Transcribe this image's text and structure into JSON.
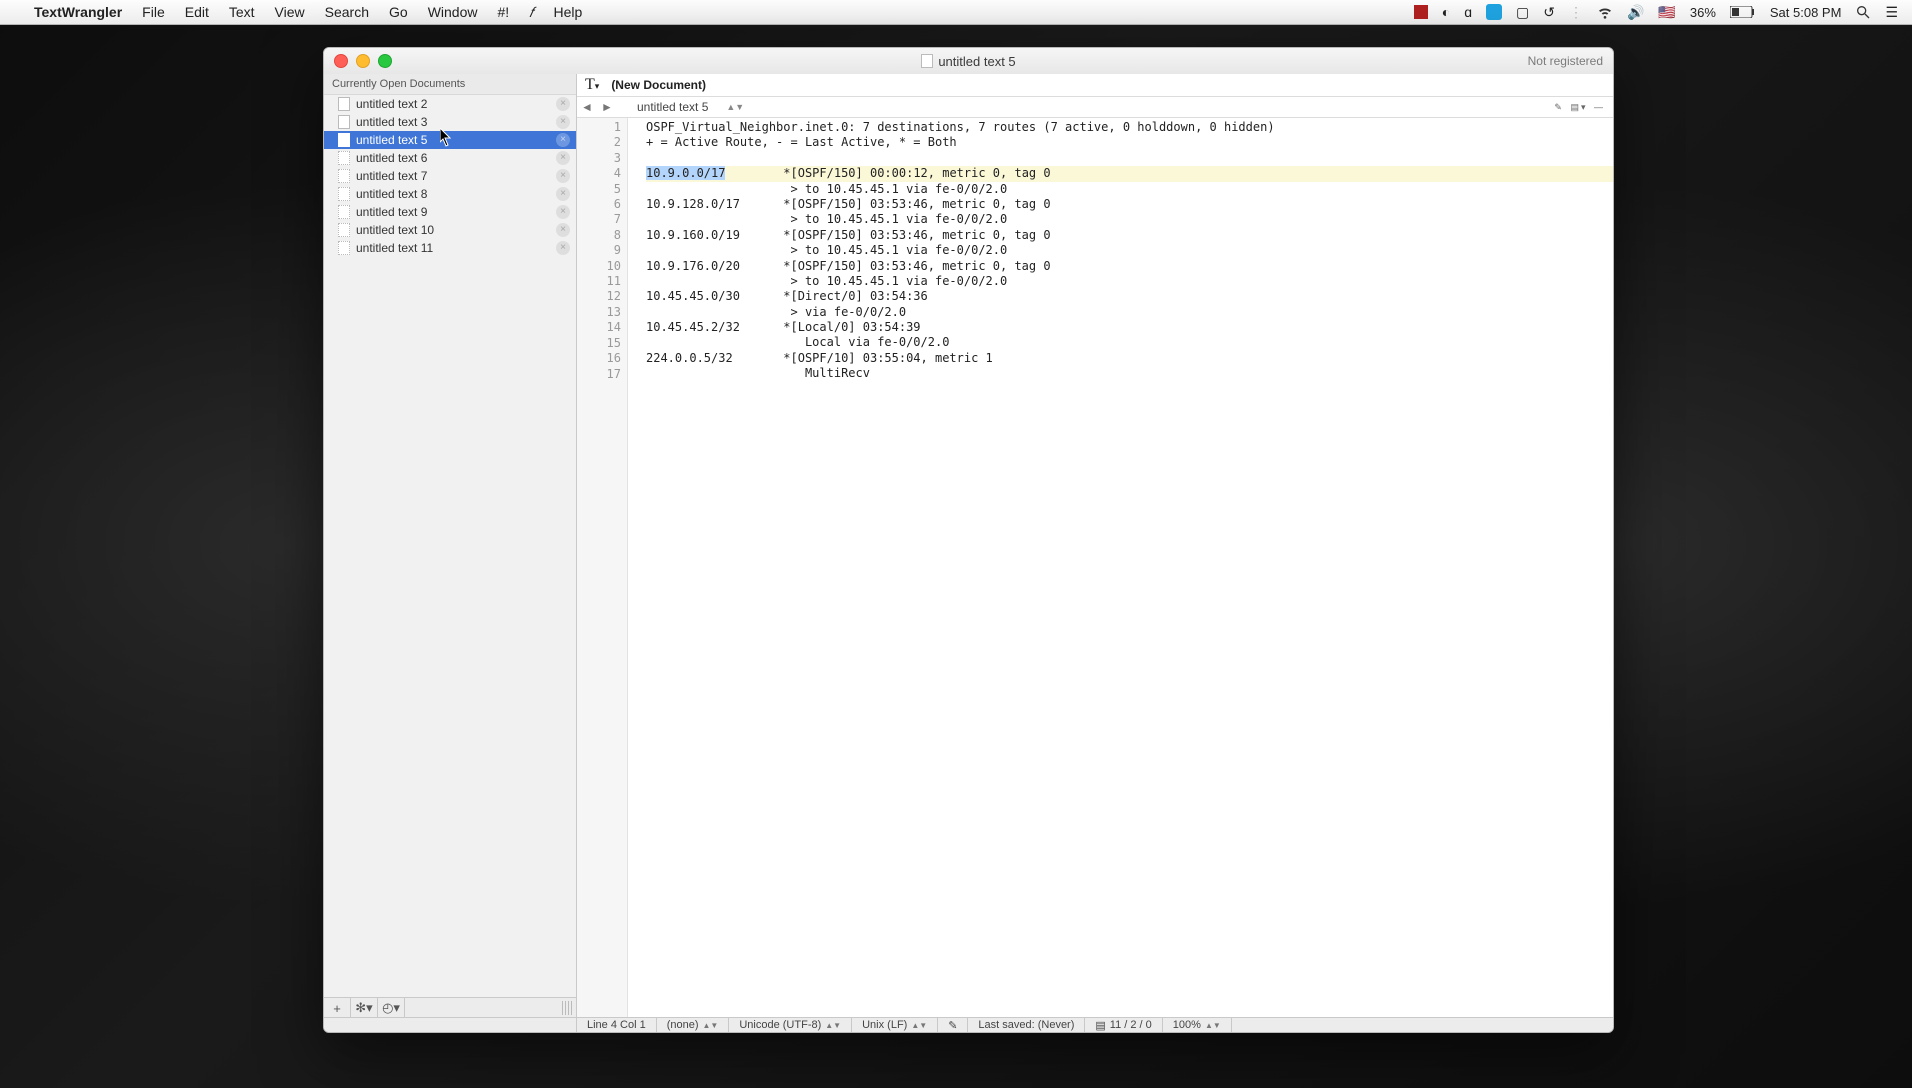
{
  "menubar": {
    "app": "TextWrangler",
    "items": [
      "File",
      "Edit",
      "Text",
      "View",
      "Search",
      "Go",
      "Window",
      "#!",
      "",
      "Help"
    ],
    "battery": "36%",
    "clock": "Sat 5:08 PM"
  },
  "window": {
    "title": "untitled text 5",
    "not_registered": "Not registered"
  },
  "sidebar": {
    "header": "Currently Open Documents",
    "docs": [
      {
        "label": "untitled text 2",
        "dirty": true,
        "sel": false
      },
      {
        "label": "untitled text 3",
        "dirty": true,
        "sel": false
      },
      {
        "label": "untitled text 5",
        "dirty": true,
        "sel": true
      },
      {
        "label": "untitled text 6",
        "dirty": false,
        "sel": false
      },
      {
        "label": "untitled text 7",
        "dirty": false,
        "sel": false
      },
      {
        "label": "untitled text 8",
        "dirty": false,
        "sel": false
      },
      {
        "label": "untitled text 9",
        "dirty": false,
        "sel": false
      },
      {
        "label": "untitled text 10",
        "dirty": false,
        "sel": false
      },
      {
        "label": "untitled text 11",
        "dirty": false,
        "sel": false
      }
    ]
  },
  "pathbar": {
    "label": "(New Document)"
  },
  "navbar": {
    "doc": "untitled text 5"
  },
  "editor": {
    "line_count": 17,
    "highlight_line": 4,
    "selection": {
      "line": 4,
      "text": "10.9.0.0/17"
    },
    "lines": [
      "OSPF_Virtual_Neighbor.inet.0: 7 destinations, 7 routes (7 active, 0 holddown, 0 hidden)",
      "+ = Active Route, - = Last Active, * = Both",
      "",
      "10.9.0.0/17        *[OSPF/150] 00:00:12, metric 0, tag 0",
      "                    > to 10.45.45.1 via fe-0/0/2.0",
      "10.9.128.0/17      *[OSPF/150] 03:53:46, metric 0, tag 0",
      "                    > to 10.45.45.1 via fe-0/0/2.0",
      "10.9.160.0/19      *[OSPF/150] 03:53:46, metric 0, tag 0",
      "                    > to 10.45.45.1 via fe-0/0/2.0",
      "10.9.176.0/20      *[OSPF/150] 03:53:46, metric 0, tag 0",
      "                    > to 10.45.45.1 via fe-0/0/2.0",
      "10.45.45.0/30      *[Direct/0] 03:54:36",
      "                    > via fe-0/0/2.0",
      "10.45.45.2/32      *[Local/0] 03:54:39",
      "                      Local via fe-0/0/2.0",
      "224.0.0.5/32       *[OSPF/10] 03:55:04, metric 1",
      "                      MultiRecv"
    ]
  },
  "status": {
    "pos": "Line 4 Col 1",
    "lang": "(none)",
    "enc": "Unicode (UTF-8)",
    "eol": "Unix (LF)",
    "saved": "Last saved: (Never)",
    "counts": "11 / 2 / 0",
    "zoom": "100%"
  }
}
